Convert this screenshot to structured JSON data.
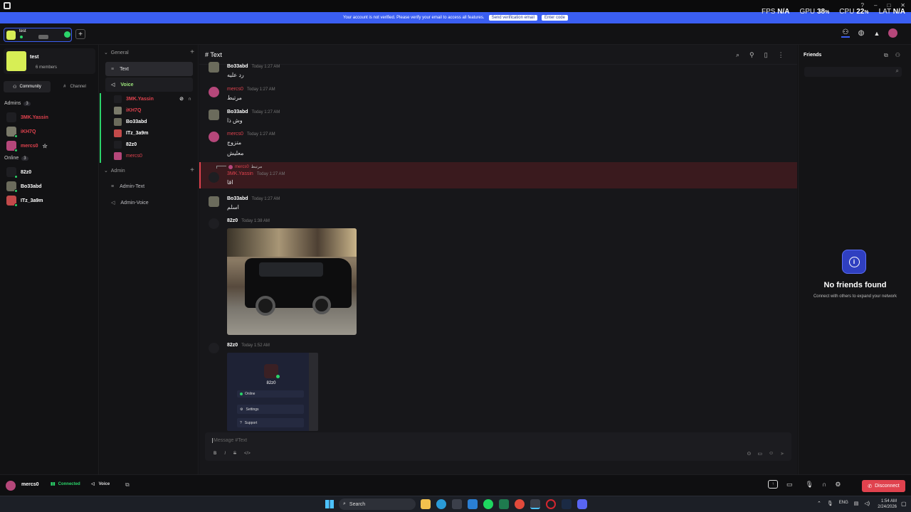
{
  "banner": {
    "text": "Your account is not verified. Please verify your email to access all features.",
    "send_btn": "Send verification email",
    "code_btn": "Enter code"
  },
  "stats": {
    "fps_label": "FPS",
    "fps_val": "N/A",
    "gpu_label": "GPU",
    "gpu_val": "38",
    "cpu_label": "CPU",
    "cpu_val": "22",
    "pct": "%",
    "lat_label": "LAT",
    "lat_val": "N/A"
  },
  "server_tab": {
    "name": "test"
  },
  "server": {
    "name": "test",
    "members": "6 members"
  },
  "side_tabs": {
    "community": "Community",
    "channel": "Channel"
  },
  "admins": {
    "label": "Admins",
    "count": "3",
    "items": [
      "3MK.Yassin",
      "iKH7Q",
      "mercs0"
    ]
  },
  "online": {
    "label": "Online",
    "count": "3",
    "items": [
      "82z0",
      "Bo33abd",
      "ITz_3a9m"
    ]
  },
  "colors": {
    "accent": "#3a5ef2",
    "admin_name": "#e0424e",
    "online_green": "#2bd46a",
    "voice_green": "#9be27a",
    "disconnect": "#e0424e",
    "server_icon": "#d7ee55"
  },
  "channels": {
    "general": "General",
    "text": "Text",
    "voice": "Voice",
    "voice_users": [
      "3MK.Yassin",
      "iKH7Q",
      "Bo33abd",
      "ITz_3a9m",
      "82z0",
      "mercs0"
    ],
    "admin": "Admin",
    "admin_text": "Admin-Text",
    "admin_voice": "Admin-Voice"
  },
  "chat": {
    "title": "# Text",
    "messages": [
      {
        "name": "Bo33abd",
        "time": "Today 1:27 AM",
        "text": "رد عليه"
      },
      {
        "name": "mercs0",
        "time": "Today 1:27 AM",
        "text": "مرتبط"
      },
      {
        "name": "Bo33abd",
        "time": "Today 1:27 AM",
        "text": "وش ذا"
      },
      {
        "name": "mercs0",
        "time": "Today 1:27 AM",
        "text": "متزوج",
        "text2": "معليش"
      },
      {
        "reply_name": "mercs0",
        "reply_text": "مرتبط",
        "name": "3MK.Yassin",
        "time": "Today 1:27 AM",
        "text": "اقا"
      },
      {
        "name": "Bo33abd",
        "time": "Today 1:27 AM",
        "text": "اسلم"
      },
      {
        "name": "82z0",
        "time": "Today 1:38 AM"
      },
      {
        "name": "82z0",
        "time": "Today 1:52 AM"
      }
    ],
    "profile_card": {
      "name": "82z0",
      "status": "Online",
      "settings": "Settings",
      "support": "Support"
    },
    "input_placeholder": "Message #Text"
  },
  "friends": {
    "title": "Friends",
    "empty_title": "No friends found",
    "empty_sub": "Connect with others to expand your network"
  },
  "bottom": {
    "user": "mercs0",
    "connected": "Connected",
    "voice": "Voice",
    "disconnect": "Disconnect"
  },
  "taskbar": {
    "search": "Search",
    "lang": "ENG",
    "time": "1:54 AM",
    "date": "2/24/2026"
  },
  "icons": [
    "app-logo-icon",
    "add-icon",
    "users-icon",
    "chat-icon",
    "bell-icon",
    "search-icon",
    "pin-icon",
    "file-icon",
    "more-icon",
    "mic-icon",
    "headphones-icon",
    "settings-icon",
    "camera-icon",
    "screen-share-icon",
    "phone-icon",
    "info-icon"
  ]
}
